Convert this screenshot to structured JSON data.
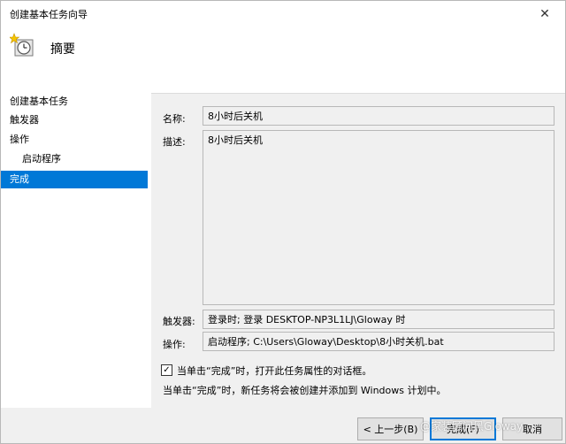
{
  "window": {
    "title": "创建基本任务向导",
    "close_glyph": "✕"
  },
  "header": {
    "title": "摘要",
    "icon": "clock-task-icon"
  },
  "nav": {
    "items": [
      {
        "label": "创建基本任务",
        "selected": false
      },
      {
        "label": "触发器",
        "selected": false
      },
      {
        "label": "操作",
        "selected": false
      },
      {
        "label": "启动程序",
        "selected": false
      },
      {
        "label": "完成",
        "selected": true
      }
    ]
  },
  "form": {
    "name_label": "名称:",
    "name_value": "8小时后关机",
    "description_label": "描述:",
    "description_value": "8小时后关机",
    "trigger_label": "触发器:",
    "trigger_value": "登录时; 登录 DESKTOP-NP3L1LJ\\Gloway 时",
    "action_label": "操作:",
    "action_value": "启动程序; C:\\Users\\Gloway\\Desktop\\8小时关机.bat"
  },
  "options": {
    "open_properties_label": "当单击“完成”时，打开此任务属性的对话框。",
    "open_properties_checked": true,
    "info_text": "当单击“完成”时，新任务将会被创建并添加到 Windows 计划中。"
  },
  "buttons": {
    "back_label": "< 上一步(B)",
    "finish_label": "完成(F)",
    "cancel_label": "取消"
  },
  "watermark": "@家装顾问黑Gloway",
  "colors": {
    "selected_bg": "#0078d7",
    "panel_bg": "#f0f0f0",
    "white": "#ffffff"
  }
}
